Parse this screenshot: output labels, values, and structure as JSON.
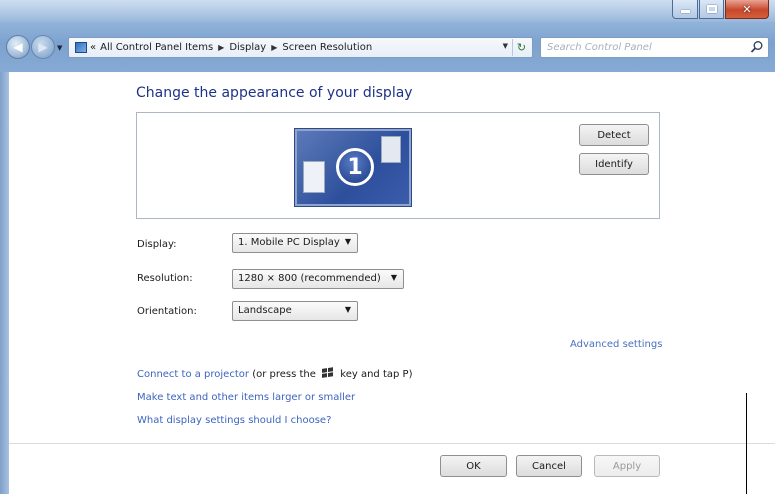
{
  "address_bar": {
    "overflow": "«",
    "crumbs": [
      "All Control Panel Items",
      "Display",
      "Screen Resolution"
    ]
  },
  "search": {
    "placeholder": "Search Control Panel"
  },
  "page": {
    "heading": "Change the appearance of your display"
  },
  "preview": {
    "monitor_number": "1"
  },
  "buttons": {
    "detect": "Detect",
    "identify": "Identify",
    "ok": "OK",
    "cancel": "Cancel",
    "apply": "Apply"
  },
  "settings": {
    "display": {
      "label": "Display:",
      "value": "1. Mobile PC Display"
    },
    "resolution": {
      "label": "Resolution:",
      "value": "1280 × 800 (recommended)"
    },
    "orientation": {
      "label": "Orientation:",
      "value": "Landscape"
    }
  },
  "links": {
    "advanced": "Advanced settings",
    "projector": "Connect to a projector",
    "projector_hint_pre": "(or press the",
    "projector_hint_post": "key and tap P)",
    "text_size": "Make text and other items larger or smaller",
    "help": "What display settings should I choose?"
  },
  "icons": {
    "back": "back-arrow-icon",
    "forward": "forward-arrow-icon",
    "control_panel": "control-panel-icon",
    "refresh": "refresh-icon",
    "search": "search-icon",
    "windows_key": "windows-logo-icon"
  }
}
